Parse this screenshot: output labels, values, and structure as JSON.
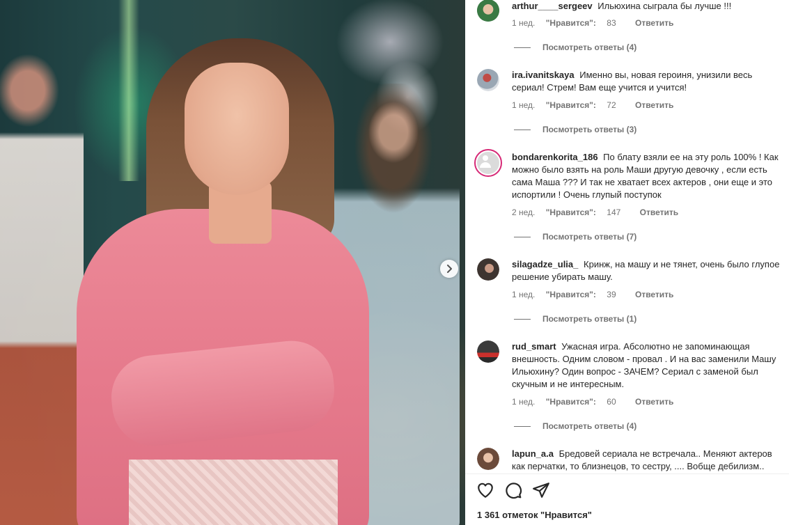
{
  "post": {
    "image_alt": "",
    "next_button": "chevron-right-icon"
  },
  "comments": [
    {
      "username": "arthur____sergeev",
      "text": "Ильюхина сыграла бы лучше !!!",
      "time": "1 нед.",
      "likes_label": "\"Нравится\":",
      "likes_count": "83",
      "reply_label": "Ответить",
      "view_replies": "Посмотреть ответы (4)"
    },
    {
      "username": "ira.ivanitskaya",
      "text": "Именно вы, новая героиня, унизили весь сериал! Стрем! Вам еще учится и учится!",
      "time": "1 нед.",
      "likes_label": "\"Нравится\":",
      "likes_count": "72",
      "reply_label": "Ответить",
      "view_replies": "Посмотреть ответы (3)"
    },
    {
      "username": "bondarenkorita_186",
      "text": "По блату взяли ее на эту роль 100% ! Как можно было взять на роль Маши другую девочку , если есть сама Маша ??? И так не хватает всех актеров , они еще и это испортили ! Очень глупый поступок",
      "time": "2 нед.",
      "likes_label": "\"Нравится\":",
      "likes_count": "147",
      "reply_label": "Ответить",
      "view_replies": "Посмотреть ответы (7)"
    },
    {
      "username": "silagadze_ulia_",
      "text": "Кринж, на машу и не тянет, очень было глупое решение убирать машу.",
      "time": "1 нед.",
      "likes_label": "\"Нравится\":",
      "likes_count": "39",
      "reply_label": "Ответить",
      "view_replies": "Посмотреть ответы (1)"
    },
    {
      "username": "rud_smart",
      "text": "Ужасная игра. Абсолютно не запоминающая внешность. Одним словом - провал . И на вас заменили Машу Ильюхину? Один вопрос - ЗАЧЕМ? Сериал с заменой был скучным и не интересным.",
      "time": "1 нед.",
      "likes_label": "\"Нравится\":",
      "likes_count": "60",
      "reply_label": "Ответить",
      "view_replies": "Посмотреть ответы (4)"
    },
    {
      "username": "lapun_a.a",
      "text": "Бредовей сериала не встречала.. Меняют актеров как перчатки, то близнецов, то сестру, .... Вобще дебилизм.."
    }
  ],
  "actions": {
    "like_icon": "heart-icon",
    "comment_icon": "comment-icon",
    "share_icon": "share-icon",
    "likes_total": "1 361 отметок \"Нравится\""
  },
  "colors": {
    "text": "#262626",
    "secondary": "#737373",
    "story_ring": "#d62976"
  }
}
